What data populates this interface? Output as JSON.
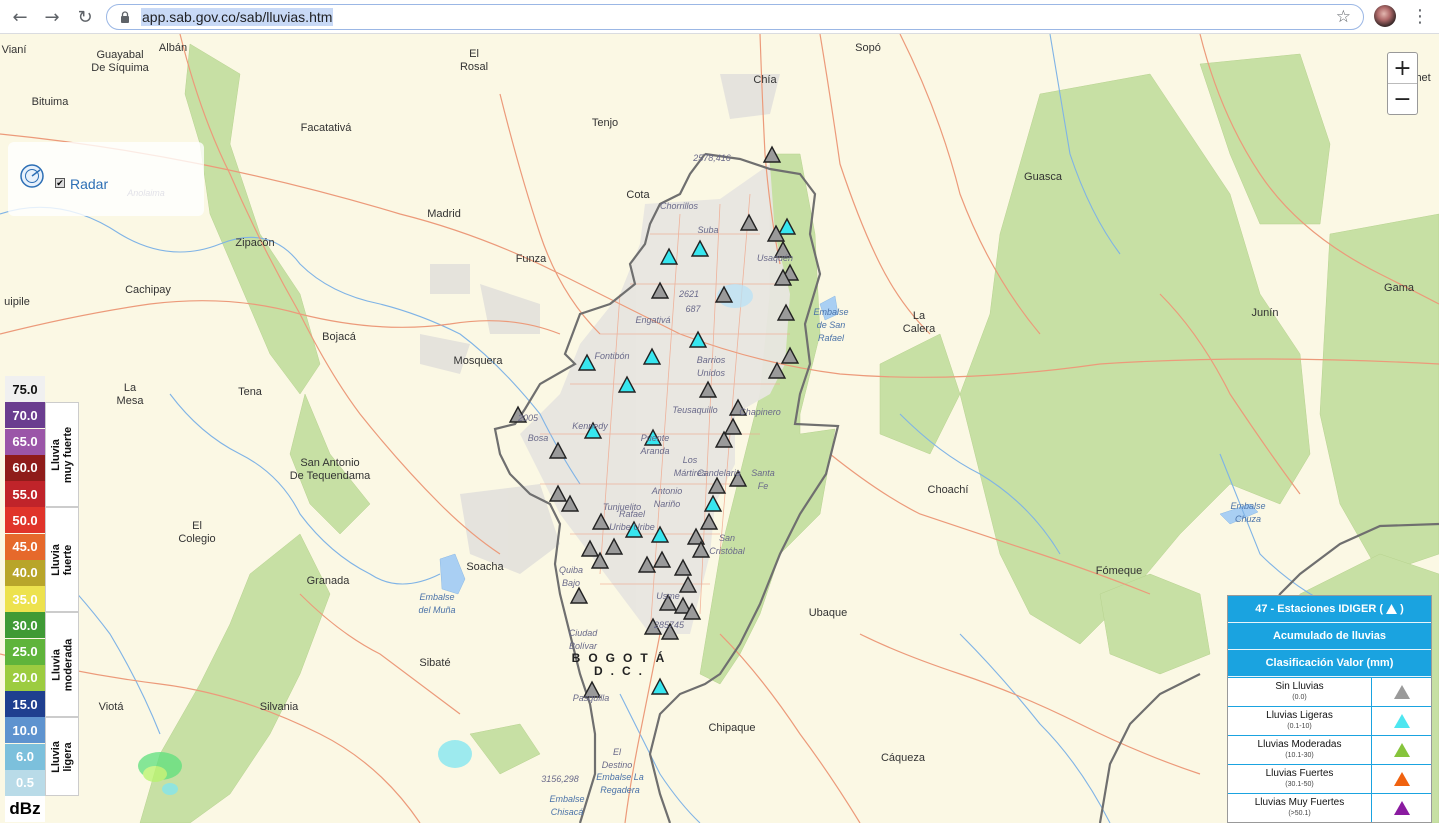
{
  "browser": {
    "url": "app.sab.gov.co/sab/lluvias.htm",
    "back_icon": "arrow-left-icon",
    "forward_icon": "arrow-right-icon",
    "reload_icon": "reload-icon"
  },
  "map": {
    "zoom_in_label": "+",
    "zoom_out_label": "−",
    "radar_label": "Radar",
    "places": [
      "Vianí",
      "Albán",
      "Guayabal\nDe Síquima",
      "El\nRosal",
      "Sopó",
      "Chía",
      "Gachet",
      "Bituima",
      "Tenjo",
      "Facatativá",
      "2578,416",
      "Cota",
      "Chorrillos",
      "Madrid",
      "Suba",
      "Usaquén",
      "Guasca",
      "Zipacón",
      "Funza",
      "Anolaima",
      "Cachipay",
      "2621",
      "687",
      "Engativá",
      "Embalse\nde San\nRafael",
      "La\nCalera",
      "Junín",
      "Gama",
      "uipile",
      "Bojacá",
      "Mosquera",
      "Fontibón",
      "Barrios\nUnidos",
      "La\nMesa",
      "Tena",
      "Teusaquillo",
      "Chapinero",
      "2005",
      "Bosa",
      "Kennedy",
      "Puente\nAranda",
      "Los\nMártires",
      "Candelaria",
      "Santa\nFe",
      "San Antonio\nDe Tequendama",
      "Tunjuelito",
      "Rafael\nUribe Uribe",
      "Antonio\nNariño",
      "Choachí",
      "Embalse\nChuza",
      "El\nColegio",
      "San\nCristóbal",
      "Quiba\nBajo",
      "Soacha",
      "Granada",
      "Fómeque",
      "Embalse\ndel Muña",
      "Usme",
      "285745",
      "Ciudad\nBolívar",
      "Ubaque",
      "Sibaté",
      "BOGOTÁ\nD.C.",
      "Viotá",
      "Silvania",
      "Pasquilla",
      "Chipaque",
      "El\nDestino",
      "3156,298",
      "Embalse La\nRegadera",
      "Embalse\nChisacá",
      "Cáqueza"
    ]
  },
  "dbz_legend": {
    "unit": "dBz",
    "levels": [
      {
        "value": "75.0",
        "color": "#f0f0f0",
        "text": "#111"
      },
      {
        "value": "70.0",
        "color": "#6a3d8f",
        "text": "#fff"
      },
      {
        "value": "65.0",
        "color": "#9b56a8",
        "text": "#fff"
      },
      {
        "value": "60.0",
        "color": "#8f1c1a",
        "text": "#fff"
      },
      {
        "value": "55.0",
        "color": "#c0242a",
        "text": "#fff"
      },
      {
        "value": "50.0",
        "color": "#e0342a",
        "text": "#fff"
      },
      {
        "value": "45.0",
        "color": "#e6692b",
        "text": "#fff"
      },
      {
        "value": "40.0",
        "color": "#b8a52a",
        "text": "#fff"
      },
      {
        "value": "35.0",
        "color": "#ede24e",
        "text": "#fff"
      },
      {
        "value": "30.0",
        "color": "#3f9a35",
        "text": "#fff"
      },
      {
        "value": "25.0",
        "color": "#5fb43b",
        "text": "#fff"
      },
      {
        "value": "20.0",
        "color": "#9ccc40",
        "text": "#fff"
      },
      {
        "value": "15.0",
        "color": "#1f3f8f",
        "text": "#fff"
      },
      {
        "value": "10.0",
        "color": "#5e93cf",
        "text": "#fff"
      },
      {
        "value": "6.0",
        "color": "#7cc0dc",
        "text": "#fff"
      },
      {
        "value": "0.5",
        "color": "#b9dbe8",
        "text": "#fff"
      }
    ],
    "categories": [
      "Lluvia\nmuy fuerte",
      "Lluvia\nfuerte",
      "Lluvia\nmoderada",
      "Lluvia\nligera"
    ]
  },
  "stations_legend": {
    "header_count": "47 - Estaciones IDIGER",
    "header_acc": "Acumulado de lluvias",
    "header_class": "Clasificación Valor (mm)",
    "rows": [
      {
        "label": "Sin Lluvias",
        "range": "(0.0)",
        "color": "#9a9a9a"
      },
      {
        "label": "Lluvias Ligeras",
        "range": "(0.1-10)",
        "color": "#4de6f0"
      },
      {
        "label": "Lluvias Moderadas",
        "range": "(10.1-30)",
        "color": "#86c43c"
      },
      {
        "label": "Lluvias Fuertes",
        "range": "(30.1-50)",
        "color": "#f0620f"
      },
      {
        "label": "Lluvias Muy Fuertes",
        "range": "(>50.1)",
        "color": "#8a1ba0"
      }
    ]
  },
  "stations": {
    "total": 47,
    "sin_lluvias": 35,
    "lluvias_ligeras": 12,
    "icon_names": {
      "gray": "station-gray-triangle-icon",
      "cyan": "station-cyan-triangle-icon"
    }
  }
}
